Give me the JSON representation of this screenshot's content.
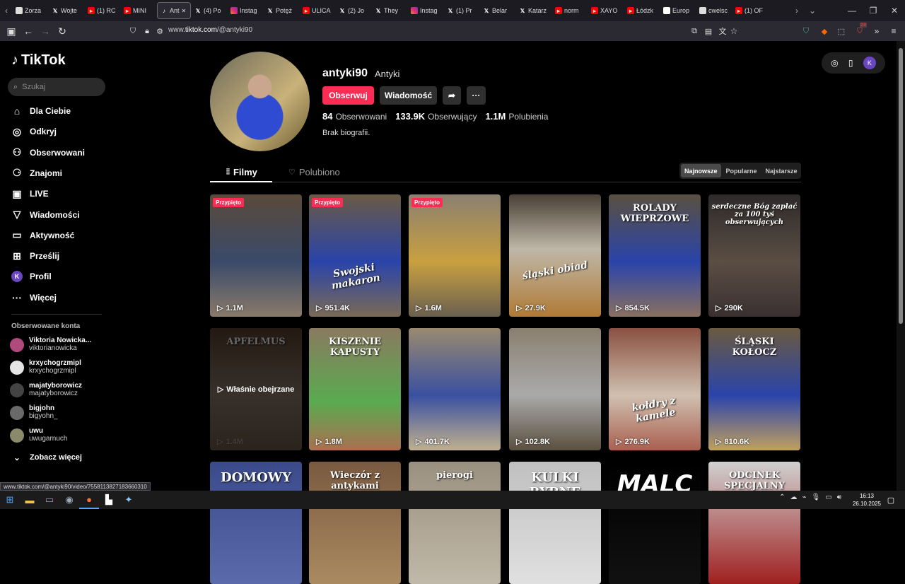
{
  "browser": {
    "tabs": [
      {
        "label": "Zorza",
        "icon": "doc"
      },
      {
        "label": "Wojte",
        "icon": "x"
      },
      {
        "label": "(1) RC",
        "icon": "yt"
      },
      {
        "label": "MINI",
        "icon": "yt"
      },
      {
        "label": "Ant",
        "icon": "tt",
        "active": true
      },
      {
        "label": "(4) Po",
        "icon": "x"
      },
      {
        "label": "Instag",
        "icon": "ig"
      },
      {
        "label": "Potęż",
        "icon": "x"
      },
      {
        "label": "ULICA",
        "icon": "yt"
      },
      {
        "label": "(2) Jo",
        "icon": "x"
      },
      {
        "label": "They",
        "icon": "x"
      },
      {
        "label": "Instag",
        "icon": "ig"
      },
      {
        "label": "(1) Pr",
        "icon": "x"
      },
      {
        "label": "Belar",
        "icon": "x"
      },
      {
        "label": "Katarz",
        "icon": "x"
      },
      {
        "label": "norm",
        "icon": "yt"
      },
      {
        "label": "XAYO",
        "icon": "yt"
      },
      {
        "label": "Łódzk",
        "icon": "yt"
      },
      {
        "label": "Europ",
        "icon": "gh"
      },
      {
        "label": "cwelsc",
        "icon": "doc"
      },
      {
        "label": "(1) OF",
        "icon": "yt"
      }
    ],
    "url_prefix": "www.",
    "url_host": "tiktok.com",
    "url_path": "/@antyki90",
    "notif_count": "23",
    "status_url": "www.tiktok.com/@antyki90/video/7558113827183660310"
  },
  "sidebar": {
    "logo": "TikTok",
    "search_placeholder": "Szukaj",
    "nav": [
      {
        "label": "Dla Ciebie",
        "icon": "home-icon"
      },
      {
        "label": "Odkryj",
        "icon": "compass-icon"
      },
      {
        "label": "Obserwowani",
        "icon": "following-icon"
      },
      {
        "label": "Znajomi",
        "icon": "friends-icon"
      },
      {
        "label": "LIVE",
        "icon": "live-icon"
      },
      {
        "label": "Wiadomości",
        "icon": "messages-icon"
      },
      {
        "label": "Aktywność",
        "icon": "activity-icon"
      },
      {
        "label": "Prześlij",
        "icon": "upload-icon"
      },
      {
        "label": "Profil",
        "icon": "profile-icon"
      },
      {
        "label": "Więcej",
        "icon": "more-icon"
      }
    ],
    "profile_initial": "K",
    "following_heading": "Obserwowane konta",
    "following": [
      {
        "name": "Viktoria Nowicka...",
        "handle": "viktorianowicka",
        "color": "#b04a7c"
      },
      {
        "name": "krxychogrzmipl",
        "handle": "krxychogrzmipl",
        "color": "#e5e5e5"
      },
      {
        "name": "majatyborowicz",
        "handle": "majatyborowicz",
        "color": "#444"
      },
      {
        "name": "bigjohn",
        "handle": "bigyohn_",
        "color": "#6a6a6a"
      },
      {
        "name": "uwu",
        "handle": "uwugarnuch",
        "color": "#8a8a6a"
      }
    ],
    "see_more": "Zobacz więcej"
  },
  "profile": {
    "username": "antyki90",
    "nickname": "Antyki",
    "follow_label": "Obserwuj",
    "message_label": "Wiadomość",
    "following_count": "84",
    "following_label": "Obserwowani",
    "followers_count": "133.9K",
    "followers_label": "Obserwujący",
    "likes_count": "1.1M",
    "likes_label": "Polubienia",
    "bio": "Brak biografii."
  },
  "tabs": {
    "videos": "Filmy",
    "liked": "Polubiono",
    "sort": [
      "Najnowsze",
      "Popularne",
      "Najstarsze"
    ]
  },
  "videos": [
    {
      "views": "1.1M",
      "pinned": "Przypięto",
      "title": "",
      "bg": "linear-gradient(180deg,#5a4a3a,#3a4a6a 55%,#8a7a6a)"
    },
    {
      "views": "951.4K",
      "pinned": "Przypięto",
      "title": "Swojski makaron",
      "bg": "linear-gradient(180deg,#6a5a44,#2a44aa 55%,#7a6a55)"
    },
    {
      "views": "1.6M",
      "pinned": "Przypięto",
      "title": "",
      "bg": "linear-gradient(180deg,#8a8070,#c9a040 55%,#6a6050)"
    },
    {
      "views": "27.9K",
      "pinned": "",
      "title": "śląski obiad",
      "bg": "linear-gradient(180deg,#4a4036,#bfb7a8 45%,#b07a35)"
    },
    {
      "views": "854.5K",
      "pinned": "",
      "title": "ROLADY WIEPRZOWE",
      "bg": "linear-gradient(180deg,#5a5040,#2a44aa 55%,#8a7060)"
    },
    {
      "views": "290K",
      "pinned": "",
      "title": "serdeczne Bóg zapłać za 100 tyś obserwujących",
      "bg": "linear-gradient(180deg,#2e2a2a,#5a4e44 55%,#3a3030)"
    },
    {
      "views": "1.4M",
      "pinned": "",
      "title": "APFELMUS",
      "watched": "Właśnie obejrzane",
      "bg": "linear-gradient(180deg,#5a4030,#8a7a6a 55%,#6a5a4a)"
    },
    {
      "views": "1.8M",
      "pinned": "",
      "title": "KISZENIE KAPUSTY",
      "bg": "linear-gradient(180deg,#8a7a60,#5aaa50 60%,#aa7050)"
    },
    {
      "views": "401.7K",
      "pinned": "",
      "title": "",
      "bg": "linear-gradient(180deg,#9a8a70,#3a50a0 55%,#c0b090)"
    },
    {
      "views": "102.8K",
      "pinned": "",
      "title": "",
      "bg": "linear-gradient(180deg,#8a8070,#aaaaaa 55%,#5a5040)"
    },
    {
      "views": "276.9K",
      "pinned": "",
      "title": "kołdry z kamele",
      "bg": "linear-gradient(180deg,#8a5040,#d0c0b0 55%,#aa6050)"
    },
    {
      "views": "810.6K",
      "pinned": "",
      "title": "ŚLĄSKI KOŁOCZ",
      "bg": "linear-gradient(180deg,#6a5a40,#2a44aa 55%,#c0a060)"
    },
    {
      "views": "",
      "pinned": "",
      "title": "DOMOWY",
      "bg": "linear-gradient(180deg,#3a4a8a,#5a6aaa)"
    },
    {
      "views": "",
      "pinned": "",
      "title": "Wieczór z antykami",
      "bg": "linear-gradient(180deg,#7a5a40,#aa8a60)"
    },
    {
      "views": "",
      "pinned": "",
      "title": "pierogi",
      "bg": "linear-gradient(180deg,#9a9080,#c0b8a8)"
    },
    {
      "views": "",
      "pinned": "",
      "title": "KULKI RYBNE",
      "bg": "linear-gradient(180deg,#c0c0c0,#e0e0e0)"
    },
    {
      "views": "",
      "pinned": "",
      "title": "MALC",
      "bg": "linear-gradient(180deg,#000,#111)"
    },
    {
      "views": "",
      "pinned": "",
      "title": "ODCINEK SPECJALNY",
      "bg": "linear-gradient(180deg,#d0d0d0,#a02020)"
    }
  ],
  "taskbar": {
    "time": "16:13",
    "date": "26.10.2025"
  },
  "colors": {
    "accent": "#fe2c55",
    "background": "#000000"
  }
}
